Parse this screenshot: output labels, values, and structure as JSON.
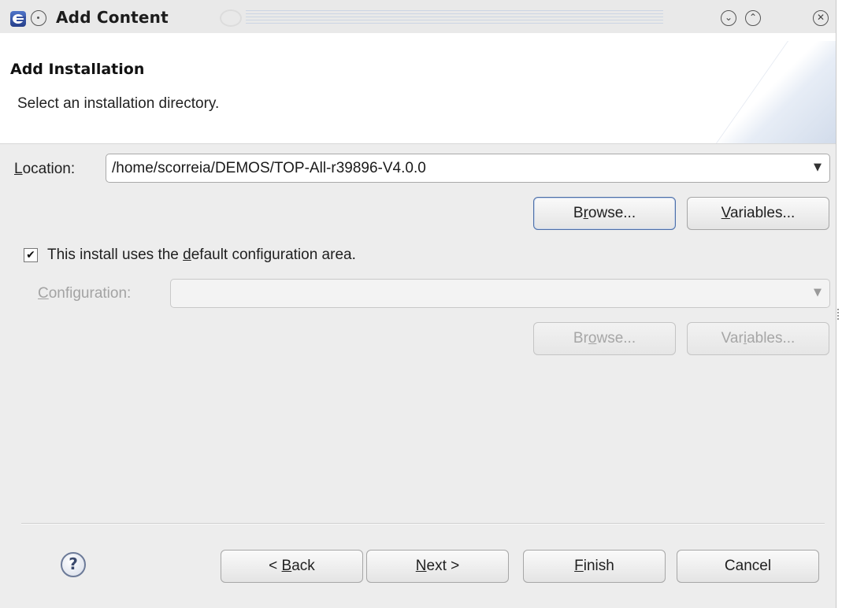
{
  "window": {
    "title": "Add Content",
    "icons": {
      "app": "eclipse-app-icon",
      "menu": "window-menu-icon",
      "minimize": "chevron-down-icon",
      "maximize": "chevron-up-icon",
      "close": "close-icon"
    },
    "button_glyphs": {
      "minimize": "⌄",
      "maximize": "⌃",
      "close": "✕"
    }
  },
  "header": {
    "title": "Add Installation",
    "description": "Select an installation directory."
  },
  "location": {
    "label_mnemonic": "L",
    "label_rest": "ocation:",
    "value": "/home/scorreia/DEMOS/TOP-All-r39896-V4.0.0",
    "arrow": "▼",
    "browse": {
      "pre": "B",
      "mnemonic": "r",
      "post": "owse..."
    },
    "variables": {
      "pre": "",
      "mnemonic": "V",
      "post": "ariables..."
    }
  },
  "default_config": {
    "checked": true,
    "check_glyph": "✔",
    "label_pre": "This install uses the ",
    "label_mnemonic": "d",
    "label_post": "efault configuration area."
  },
  "configuration": {
    "label_mnemonic": "C",
    "label_rest": "onfiguration:",
    "value": "",
    "arrow": "▼",
    "enabled": false,
    "browse": {
      "pre": "Br",
      "mnemonic": "o",
      "post": "wse..."
    },
    "variables": {
      "pre": "Var",
      "mnemonic": "i",
      "post": "ables..."
    }
  },
  "footer": {
    "help_glyph": "?",
    "back": {
      "pre": "< ",
      "mnemonic": "B",
      "post": "ack"
    },
    "next": {
      "pre": "",
      "mnemonic": "N",
      "post": "ext >"
    },
    "finish": {
      "pre": "",
      "mnemonic": "F",
      "post": "inish"
    },
    "cancel": "Cancel"
  },
  "colors": {
    "dialog_bg": "#ededed",
    "header_bg": "#ffffff",
    "focus_border": "#4d6fa8",
    "disabled_text": "#a3a3a3"
  }
}
